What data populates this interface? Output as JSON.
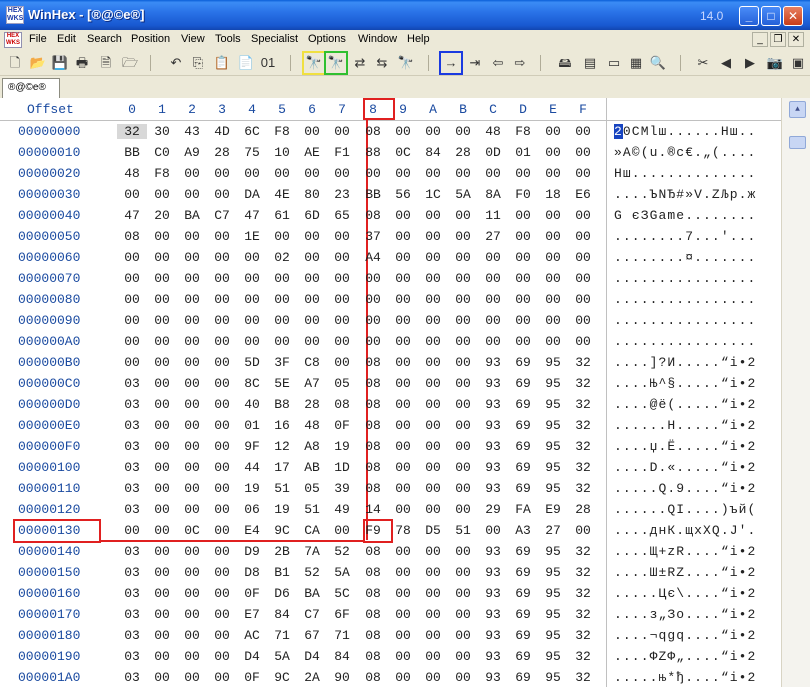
{
  "window": {
    "app_name": "WinHex",
    "title": "WinHex - [®@©e®]",
    "version": "14.0",
    "minimize": "_",
    "maximize": "□",
    "close": "✕",
    "icon_text_top": "HEX",
    "icon_text_bottom": "WKS"
  },
  "menu": {
    "items": [
      "File",
      "Edit",
      "Search",
      "Position",
      "View",
      "Tools",
      "Specialist",
      "Options",
      "Window",
      "Help"
    ],
    "mdi_minimize": "_",
    "mdi_restore": "❐",
    "mdi_close": "✕"
  },
  "toolbar": {
    "buttons": [
      {
        "name": "new-file-icon",
        "glyph": "🗋"
      },
      {
        "name": "open-folder-icon",
        "glyph": "📂"
      },
      {
        "name": "save-icon",
        "glyph": "💾"
      },
      {
        "name": "print-icon",
        "glyph": "🖶"
      },
      {
        "name": "properties-icon",
        "glyph": "🗎"
      },
      {
        "name": "open-disk-icon",
        "glyph": "🗁"
      },
      {
        "name": "undo-icon",
        "glyph": "↶"
      },
      {
        "name": "copy-icon",
        "glyph": "⎘"
      },
      {
        "name": "paste-icon",
        "glyph": "📋"
      },
      {
        "name": "clipboard-icon",
        "glyph": "📄"
      },
      {
        "name": "binary-icon",
        "glyph": "01"
      },
      {
        "name": "find-text-icon",
        "glyph": "🔭"
      },
      {
        "name": "find-hex-icon",
        "glyph": "🔭"
      },
      {
        "name": "replace-text-icon",
        "glyph": "⇄"
      },
      {
        "name": "replace-hex-icon",
        "glyph": "⇆"
      },
      {
        "name": "find-again-icon",
        "glyph": "🔭"
      },
      {
        "name": "goto-offset-icon",
        "glyph": "→"
      },
      {
        "name": "goto-sector-icon",
        "glyph": "⇥"
      },
      {
        "name": "back-icon",
        "glyph": "⇦"
      },
      {
        "name": "forward-icon",
        "glyph": "⇨"
      },
      {
        "name": "disk-editor-icon",
        "glyph": "🖴"
      },
      {
        "name": "ram-editor-icon",
        "glyph": "▤"
      },
      {
        "name": "hdd-icon",
        "glyph": "▭"
      },
      {
        "name": "calculator-icon",
        "glyph": "▦"
      },
      {
        "name": "search-icon",
        "glyph": "🔍"
      },
      {
        "name": "scissors-icon",
        "glyph": "✂"
      },
      {
        "name": "prev-icon",
        "glyph": "◀"
      },
      {
        "name": "next-icon",
        "glyph": "▶"
      },
      {
        "name": "camera-icon",
        "glyph": "📷"
      },
      {
        "name": "snapshot-icon",
        "glyph": "▣"
      }
    ],
    "highlight_yellow": "#f0e040",
    "highlight_green": "#30c030",
    "highlight_blue": "#1a3ae0"
  },
  "tab": {
    "label": "®@©e®"
  },
  "hex": {
    "offset_header": "Offset",
    "columns": [
      "0",
      "1",
      "2",
      "3",
      "4",
      "5",
      "6",
      "7",
      "8",
      "9",
      "A",
      "B",
      "C",
      "D",
      "E",
      "F"
    ],
    "rows": [
      {
        "offset": "00000000",
        "bytes": [
          "32",
          "30",
          "43",
          "4D",
          "6C",
          "F8",
          "00",
          "00",
          "08",
          "00",
          "00",
          "00",
          "48",
          "F8",
          "00",
          "00"
        ],
        "ascii": "20CMlш......Нш.."
      },
      {
        "offset": "00000010",
        "bytes": [
          "BB",
          "C0",
          "A9",
          "28",
          "75",
          "10",
          "AE",
          "F1",
          "88",
          "0C",
          "84",
          "28",
          "0D",
          "01",
          "00",
          "00"
        ],
        "ascii": "»А©(u.®c€.„(...."
      },
      {
        "offset": "00000020",
        "bytes": [
          "48",
          "F8",
          "00",
          "00",
          "00",
          "00",
          "00",
          "00",
          "00",
          "00",
          "00",
          "00",
          "00",
          "00",
          "00",
          "00"
        ],
        "ascii": "Нш.............."
      },
      {
        "offset": "00000030",
        "bytes": [
          "00",
          "00",
          "00",
          "00",
          "DA",
          "4E",
          "80",
          "23",
          "BB",
          "56",
          "1C",
          "5A",
          "8A",
          "F0",
          "18",
          "E6"
        ],
        "ascii": "....ЪNЂ#»V.ZЉр.ж"
      },
      {
        "offset": "00000040",
        "bytes": [
          "47",
          "20",
          "BA",
          "C7",
          "47",
          "61",
          "6D",
          "65",
          "08",
          "00",
          "00",
          "00",
          "11",
          "00",
          "00",
          "00"
        ],
        "ascii": "G єЗGame........"
      },
      {
        "offset": "00000050",
        "bytes": [
          "08",
          "00",
          "00",
          "00",
          "1E",
          "00",
          "00",
          "00",
          "37",
          "00",
          "00",
          "00",
          "27",
          "00",
          "00",
          "00"
        ],
        "ascii": "........7...'..."
      },
      {
        "offset": "00000060",
        "bytes": [
          "00",
          "00",
          "00",
          "00",
          "00",
          "02",
          "00",
          "00",
          "A4",
          "00",
          "00",
          "00",
          "00",
          "00",
          "00",
          "00"
        ],
        "ascii": "........¤......."
      },
      {
        "offset": "00000070",
        "bytes": [
          "00",
          "00",
          "00",
          "00",
          "00",
          "00",
          "00",
          "00",
          "00",
          "00",
          "00",
          "00",
          "00",
          "00",
          "00",
          "00"
        ],
        "ascii": "................"
      },
      {
        "offset": "00000080",
        "bytes": [
          "00",
          "00",
          "00",
          "00",
          "00",
          "00",
          "00",
          "00",
          "00",
          "00",
          "00",
          "00",
          "00",
          "00",
          "00",
          "00"
        ],
        "ascii": "................"
      },
      {
        "offset": "00000090",
        "bytes": [
          "00",
          "00",
          "00",
          "00",
          "00",
          "00",
          "00",
          "00",
          "00",
          "00",
          "00",
          "00",
          "00",
          "00",
          "00",
          "00"
        ],
        "ascii": "................"
      },
      {
        "offset": "000000A0",
        "bytes": [
          "00",
          "00",
          "00",
          "00",
          "00",
          "00",
          "00",
          "00",
          "00",
          "00",
          "00",
          "00",
          "00",
          "00",
          "00",
          "00"
        ],
        "ascii": "................"
      },
      {
        "offset": "000000B0",
        "bytes": [
          "00",
          "00",
          "00",
          "00",
          "5D",
          "3F",
          "C8",
          "00",
          "08",
          "00",
          "00",
          "00",
          "93",
          "69",
          "95",
          "32"
        ],
        "ascii": "....]?И.....“i•2"
      },
      {
        "offset": "000000C0",
        "bytes": [
          "03",
          "00",
          "00",
          "00",
          "8C",
          "5E",
          "A7",
          "05",
          "08",
          "00",
          "00",
          "00",
          "93",
          "69",
          "95",
          "32"
        ],
        "ascii": "....Њ^§.....“i•2"
      },
      {
        "offset": "000000D0",
        "bytes": [
          "03",
          "00",
          "00",
          "00",
          "40",
          "B8",
          "28",
          "08",
          "08",
          "00",
          "00",
          "00",
          "93",
          "69",
          "95",
          "32"
        ],
        "ascii": "....@ё(.....“i•2"
      },
      {
        "offset": "000000E0",
        "bytes": [
          "03",
          "00",
          "00",
          "00",
          "01",
          "16",
          "48",
          "0F",
          "08",
          "00",
          "00",
          "00",
          "93",
          "69",
          "95",
          "32"
        ],
        "ascii": "......H.....“i•2"
      },
      {
        "offset": "000000F0",
        "bytes": [
          "03",
          "00",
          "00",
          "00",
          "9F",
          "12",
          "A8",
          "19",
          "08",
          "00",
          "00",
          "00",
          "93",
          "69",
          "95",
          "32"
        ],
        "ascii": "....џ.Ё.....“i•2"
      },
      {
        "offset": "00000100",
        "bytes": [
          "03",
          "00",
          "00",
          "00",
          "44",
          "17",
          "AB",
          "1D",
          "08",
          "00",
          "00",
          "00",
          "93",
          "69",
          "95",
          "32"
        ],
        "ascii": "....D.«.....“i•2"
      },
      {
        "offset": "00000110",
        "bytes": [
          "03",
          "00",
          "00",
          "00",
          "19",
          "51",
          "05",
          "39",
          "08",
          "00",
          "00",
          "00",
          "93",
          "69",
          "95",
          "32"
        ],
        "ascii": ".....Q.9....“i•2"
      },
      {
        "offset": "00000120",
        "bytes": [
          "03",
          "00",
          "00",
          "00",
          "06",
          "19",
          "51",
          "49",
          "14",
          "00",
          "00",
          "00",
          "29",
          "FA",
          "E9",
          "28"
        ],
        "ascii": "......QI....)ъй("
      },
      {
        "offset": "00000130",
        "bytes": [
          "00",
          "00",
          "0C",
          "00",
          "E4",
          "9C",
          "CA",
          "00",
          "F9",
          "78",
          "D5",
          "51",
          "00",
          "A3",
          "27",
          "00"
        ],
        "ascii": "....днК.щxХQ.Ј'."
      },
      {
        "offset": "00000140",
        "bytes": [
          "03",
          "00",
          "00",
          "00",
          "D9",
          "2B",
          "7A",
          "52",
          "08",
          "00",
          "00",
          "00",
          "93",
          "69",
          "95",
          "32"
        ],
        "ascii": "....Щ+zR....“i•2"
      },
      {
        "offset": "00000150",
        "bytes": [
          "03",
          "00",
          "00",
          "00",
          "D8",
          "B1",
          "52",
          "5A",
          "08",
          "00",
          "00",
          "00",
          "93",
          "69",
          "95",
          "32"
        ],
        "ascii": "....Ш±RZ....“i•2"
      },
      {
        "offset": "00000160",
        "bytes": [
          "03",
          "00",
          "00",
          "00",
          "0F",
          "D6",
          "BA",
          "5C",
          "08",
          "00",
          "00",
          "00",
          "93",
          "69",
          "95",
          "32"
        ],
        "ascii": ".....Цє\\....“i•2"
      },
      {
        "offset": "00000170",
        "bytes": [
          "03",
          "00",
          "00",
          "00",
          "E7",
          "84",
          "C7",
          "6F",
          "08",
          "00",
          "00",
          "00",
          "93",
          "69",
          "95",
          "32"
        ],
        "ascii": "....з„Зo....“i•2"
      },
      {
        "offset": "00000180",
        "bytes": [
          "03",
          "00",
          "00",
          "00",
          "AC",
          "71",
          "67",
          "71",
          "08",
          "00",
          "00",
          "00",
          "93",
          "69",
          "95",
          "32"
        ],
        "ascii": "....¬qgq....“i•2"
      },
      {
        "offset": "00000190",
        "bytes": [
          "03",
          "00",
          "00",
          "00",
          "D4",
          "5A",
          "D4",
          "84",
          "08",
          "00",
          "00",
          "00",
          "93",
          "69",
          "95",
          "32"
        ],
        "ascii": "....ФZФ„....“i•2"
      },
      {
        "offset": "000001A0",
        "bytes": [
          "03",
          "00",
          "00",
          "00",
          "0F",
          "9C",
          "2A",
          "90",
          "08",
          "00",
          "00",
          "00",
          "93",
          "69",
          "95",
          "32"
        ],
        "ascii": ".....њ*ђ....“i•2"
      }
    ]
  },
  "scrollbar": {
    "up": "▲",
    "down": "▼"
  }
}
